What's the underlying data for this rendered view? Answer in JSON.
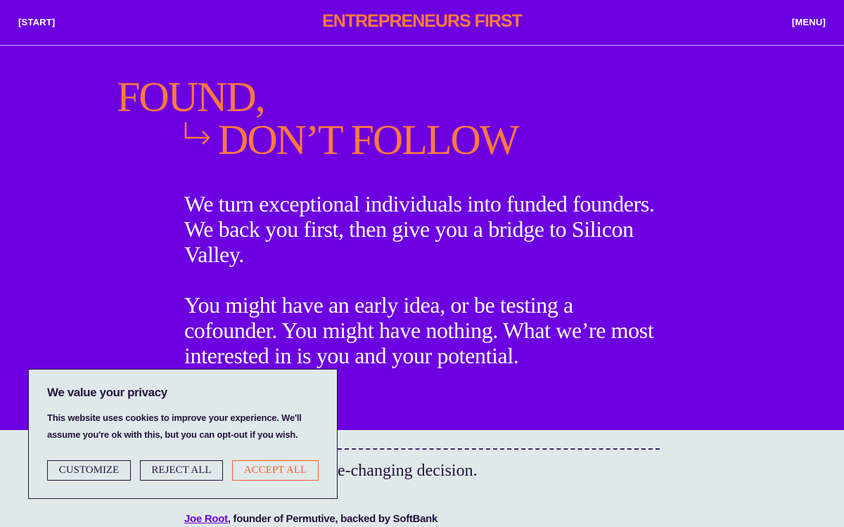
{
  "header": {
    "start_label": "[START]",
    "logo_text": "ENTREPRENEURS FIRST",
    "menu_label": "[MENU]"
  },
  "hero": {
    "line1": "FOUND,",
    "line2": "DON’T FOLLOW",
    "arrow_icon": "arrow-down-right-icon"
  },
  "intro": {
    "paragraph1": "We turn exceptional individuals into funded founders. We back you first, then give you a bridge to Silicon Valley.",
    "paragraph2": "You might have an early idea, or be testing a cofounder. You might have nothing. What we’re most interested in is you and your potential."
  },
  "testimonial": {
    "quote_visible": "fe-changing decision.",
    "author_name": "Joe Root",
    "author_rest": ", founder of Permutive, backed by SoftBank"
  },
  "cookie_banner": {
    "title": "We value your privacy",
    "text": "This website uses cookies to improve your experience. We'll assume you're ok with this, but you can opt-out if you wish.",
    "customize_label": "CUSTOMIZE",
    "reject_label": "REJECT ALL",
    "accept_label": "ACCEPT ALL"
  },
  "colors": {
    "background": "#6c00e0",
    "accent": "#ff7a3d",
    "lower_background": "#dfe9ea",
    "dark_text": "#24123f",
    "accept_button": "#ff5a2a"
  }
}
